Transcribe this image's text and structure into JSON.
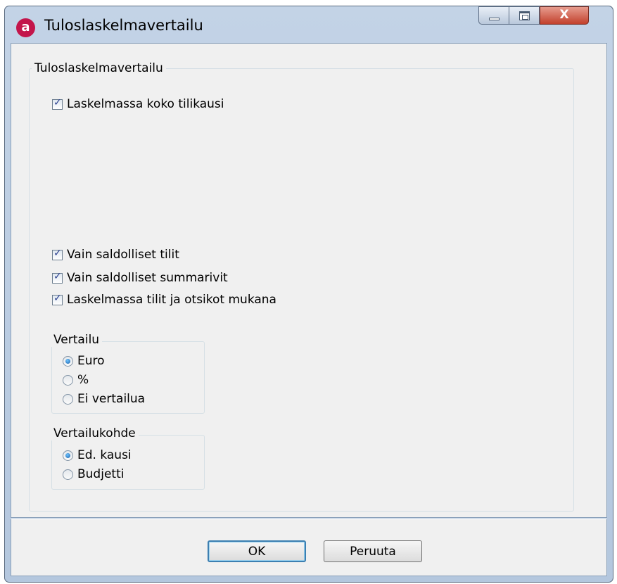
{
  "window": {
    "title": "Tuloslaskelmavertailu",
    "app_icon_letter": "a",
    "close_glyph": "X"
  },
  "main_group": {
    "legend": "Tuloslaskelmavertailu",
    "checkboxes": [
      {
        "label": "Laskelmassa koko tilikausi",
        "checked": true
      },
      {
        "label": "Vain saldolliset tilit",
        "checked": true
      },
      {
        "label": "Vain saldolliset summarivit",
        "checked": true
      },
      {
        "label": "Laskelmassa tilit  ja otsikot mukana",
        "checked": true
      }
    ]
  },
  "vertailu_group": {
    "legend": "Vertailu",
    "options": [
      {
        "label": "Euro",
        "selected": true
      },
      {
        "label": "%",
        "selected": false
      },
      {
        "label": "Ei vertailua",
        "selected": false
      }
    ]
  },
  "vertailukohde_group": {
    "legend": "Vertailukohde",
    "options": [
      {
        "label": "Ed. kausi",
        "selected": true
      },
      {
        "label": "Budjetti",
        "selected": false
      }
    ]
  },
  "buttons": {
    "ok": "OK",
    "cancel": "Peruuta"
  },
  "colors": {
    "app_icon": "#c3154b",
    "close_button": "#c2402c",
    "default_button_border": "#3c7fb1"
  }
}
